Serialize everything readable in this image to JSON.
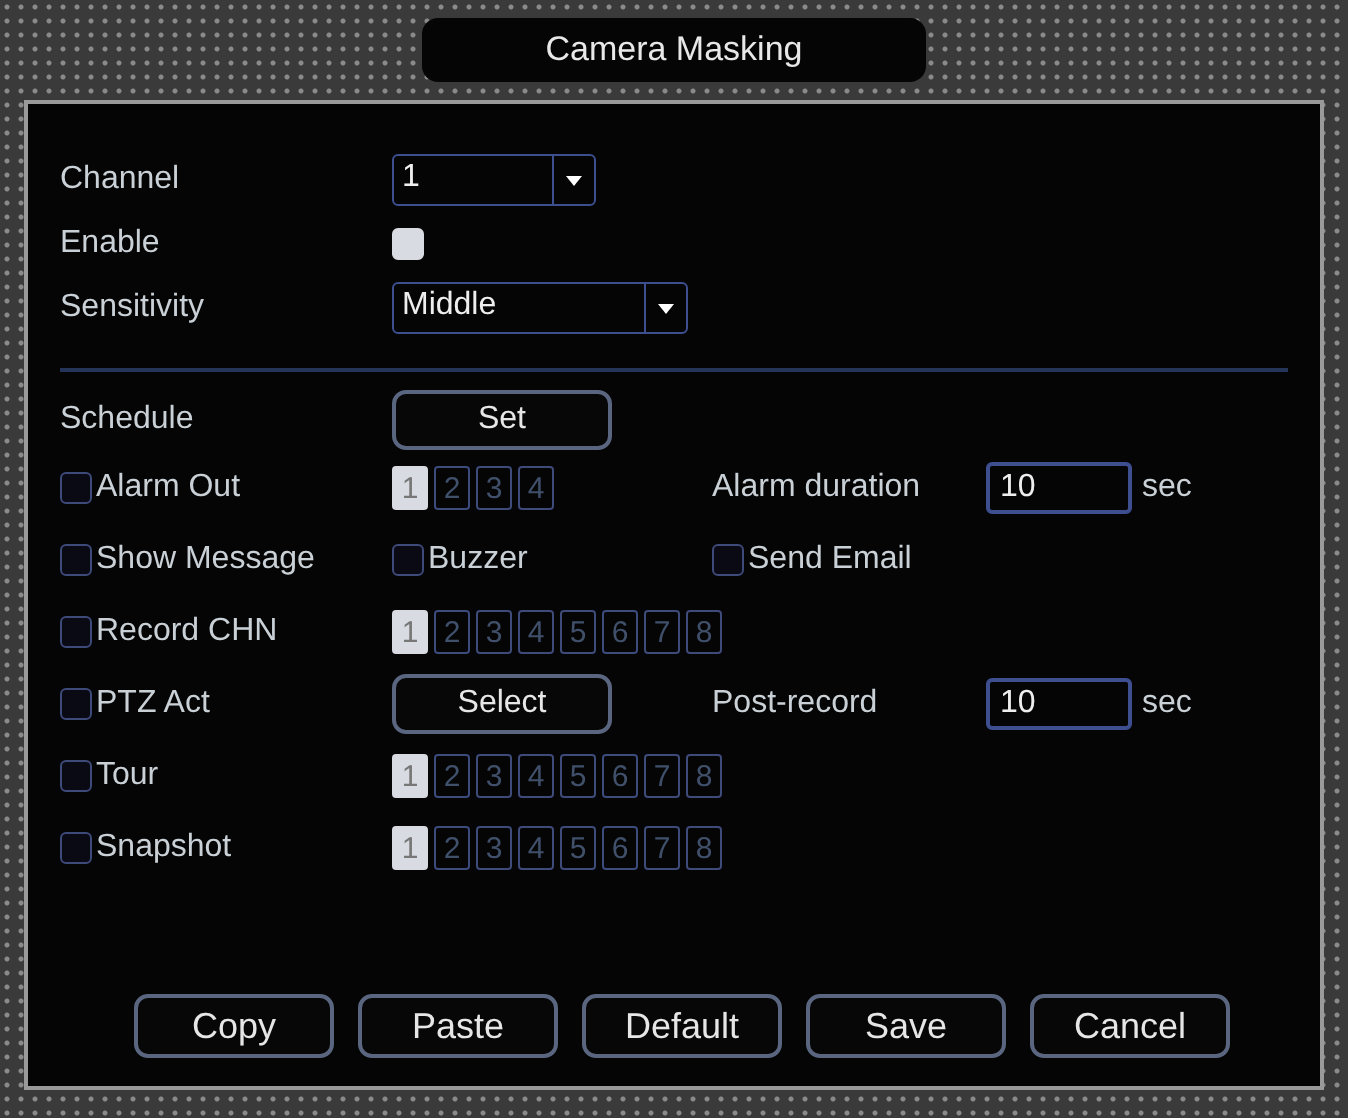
{
  "window": {
    "title": "Camera Masking"
  },
  "settings": [
    {
      "kind": "select",
      "label": "Channel",
      "value": "1"
    },
    {
      "kind": "checkbox",
      "label": "Enable",
      "checked": true
    },
    {
      "kind": "select",
      "label": "Sensitivity",
      "value": "Middle"
    }
  ],
  "schedule": {
    "label": "Schedule",
    "button": "Set"
  },
  "rows": [
    {
      "kind": "channels",
      "label": "Alarm Out",
      "checked": false,
      "channels": [
        {
          "label": "1",
          "selected": true
        },
        {
          "label": "2",
          "selected": false
        },
        {
          "label": "3",
          "selected": false
        },
        {
          "label": "4",
          "selected": false
        }
      ],
      "field": {
        "label": "Alarm duration",
        "value": "10",
        "unit": "sec"
      }
    },
    {
      "kind": "checks",
      "label": "Show Message",
      "checked": false,
      "checks": [
        {
          "label": "Buzzer",
          "checked": false
        },
        {
          "label": "Send Email",
          "checked": false
        }
      ]
    },
    {
      "kind": "channels",
      "label": "Record CHN",
      "checked": false,
      "channels": [
        {
          "label": "1",
          "selected": true
        },
        {
          "label": "2",
          "selected": false
        },
        {
          "label": "3",
          "selected": false
        },
        {
          "label": "4",
          "selected": false
        },
        {
          "label": "5",
          "selected": false
        },
        {
          "label": "6",
          "selected": false
        },
        {
          "label": "7",
          "selected": false
        },
        {
          "label": "8",
          "selected": false
        }
      ]
    },
    {
      "kind": "button",
      "label": "PTZ Act",
      "checked": false,
      "button": "Select",
      "field": {
        "label": "Post-record",
        "value": "10",
        "unit": "sec"
      }
    },
    {
      "kind": "channels",
      "label": "Tour",
      "checked": false,
      "channels": [
        {
          "label": "1",
          "selected": true
        },
        {
          "label": "2",
          "selected": false
        },
        {
          "label": "3",
          "selected": false
        },
        {
          "label": "4",
          "selected": false
        },
        {
          "label": "5",
          "selected": false
        },
        {
          "label": "6",
          "selected": false
        },
        {
          "label": "7",
          "selected": false
        },
        {
          "label": "8",
          "selected": false
        }
      ]
    },
    {
      "kind": "channels",
      "label": "Snapshot",
      "checked": false,
      "channels": [
        {
          "label": "1",
          "selected": true
        },
        {
          "label": "2",
          "selected": false
        },
        {
          "label": "3",
          "selected": false
        },
        {
          "label": "4",
          "selected": false
        },
        {
          "label": "5",
          "selected": false
        },
        {
          "label": "6",
          "selected": false
        },
        {
          "label": "7",
          "selected": false
        },
        {
          "label": "8",
          "selected": false
        }
      ]
    }
  ],
  "buttons": [
    "Copy",
    "Paste",
    "Default",
    "Save",
    "Cancel"
  ]
}
